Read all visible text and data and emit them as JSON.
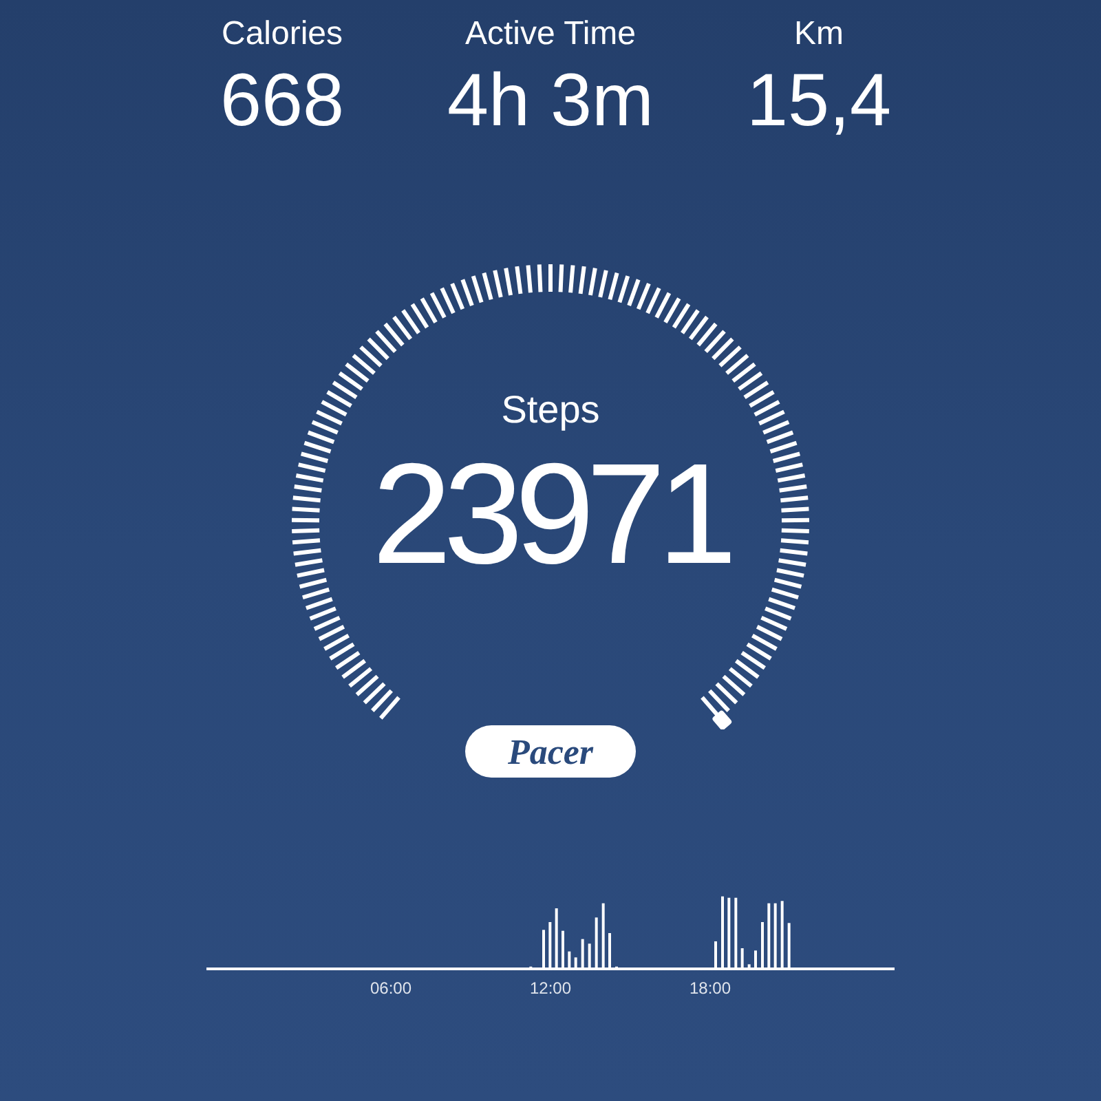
{
  "stats": [
    {
      "label": "Calories",
      "value": "668"
    },
    {
      "label": "Active Time",
      "value": "4h 3m"
    },
    {
      "label": "Km",
      "value": "15,4"
    }
  ],
  "gauge": {
    "label": "Steps",
    "value": "23971"
  },
  "brand": "Pacer",
  "timeline": {
    "labels": [
      "06:00",
      "12:00",
      "18:00"
    ]
  }
}
